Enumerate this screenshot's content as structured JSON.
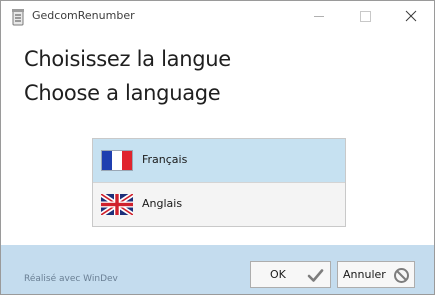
{
  "window": {
    "title": "GedcomRenumber"
  },
  "headings": {
    "line1": "Choisissez la langue",
    "line2": "Choose a language"
  },
  "languages": [
    {
      "label": "Français",
      "flag": "france-flag-icon",
      "selected": true
    },
    {
      "label": "Anglais",
      "flag": "uk-flag-icon",
      "selected": false
    }
  ],
  "footer": {
    "credit": "Réalisé avec WinDev",
    "ok_label": "OK",
    "cancel_label": "Annuler"
  },
  "colors": {
    "selected_row": "#c6e1f1",
    "footer_bg": "#c4dcee",
    "credit_text": "#6a7f94"
  }
}
